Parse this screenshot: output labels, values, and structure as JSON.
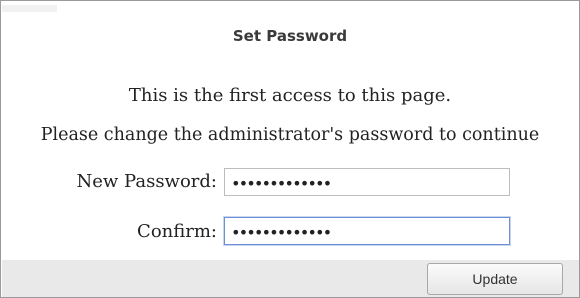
{
  "dialog": {
    "title": "Set Password",
    "messages": {
      "line1": "This is the first access to this page.",
      "line2": "Please change the administrator's password to continue"
    }
  },
  "form": {
    "new_password": {
      "label": "New Password:",
      "value": "•••••••••••••"
    },
    "confirm": {
      "label": "Confirm:",
      "value": "•••••••••••••"
    }
  },
  "footer": {
    "update_label": "Update"
  }
}
